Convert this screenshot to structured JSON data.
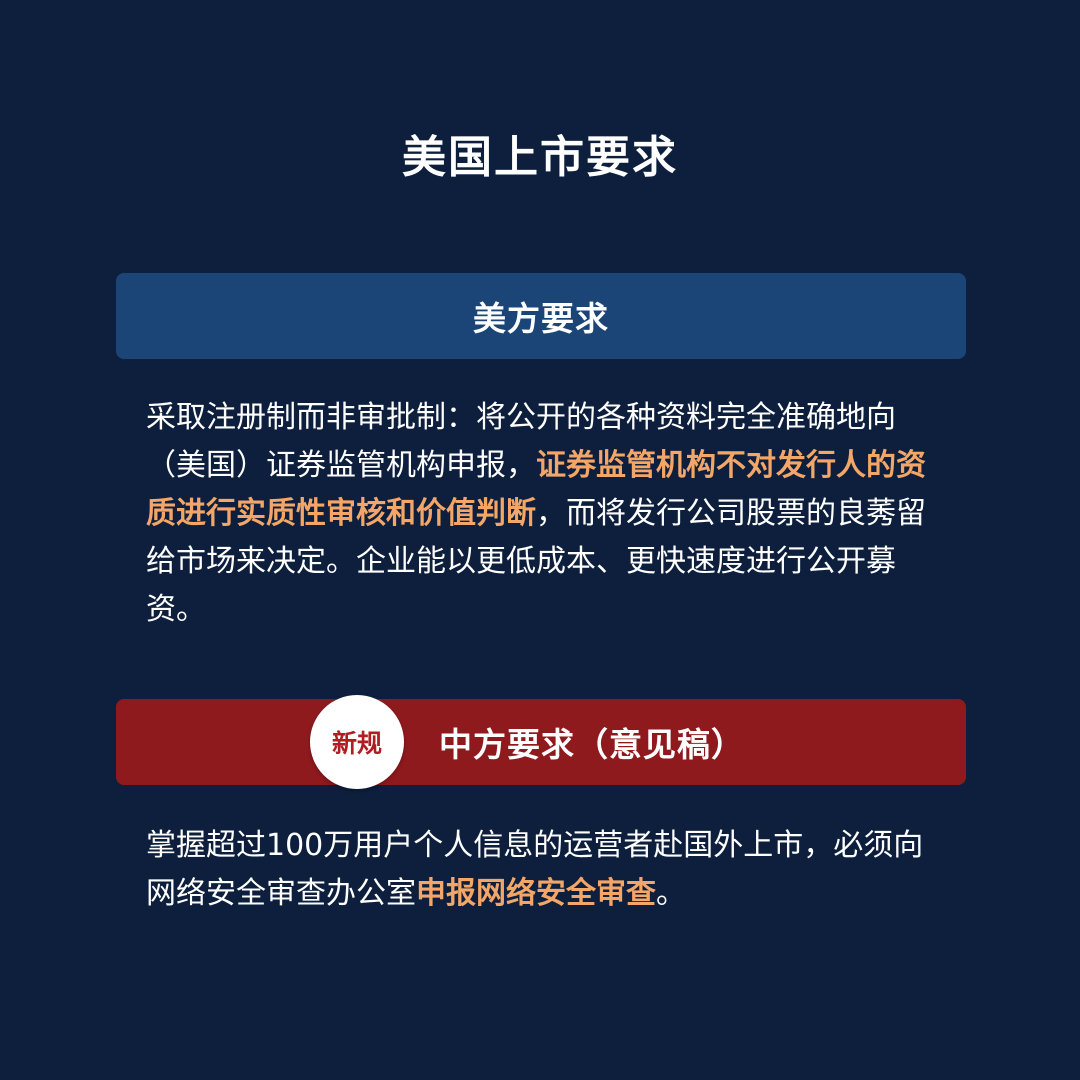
{
  "title": "美国上市要求",
  "us_section": {
    "header": "美方要求",
    "text_before": "采取注册制而非审批制：将公开的各种资料完全准确地向（美国）证券监管机构申报，",
    "highlight": "证券监管机构不对发行人的资质进行实质性审核和价值判断",
    "text_after": "，而将发行公司股票的良莠留给市场来决定。企业能以更低成本、更快速度进行公开募资。"
  },
  "cn_section": {
    "badge": "新规",
    "header": "中方要求（意见稿）",
    "text_before": "掌握超过100万用户个人信息的运营者赴国外上市，必须向网络安全审查办公室",
    "highlight": "申报网络安全审查",
    "text_after": "。"
  },
  "colors": {
    "background": "#0d1f3c",
    "us_banner": "#1b4576",
    "cn_banner": "#8f1a1e",
    "highlight": "#f3a667",
    "badge_text": "#b01e23"
  }
}
